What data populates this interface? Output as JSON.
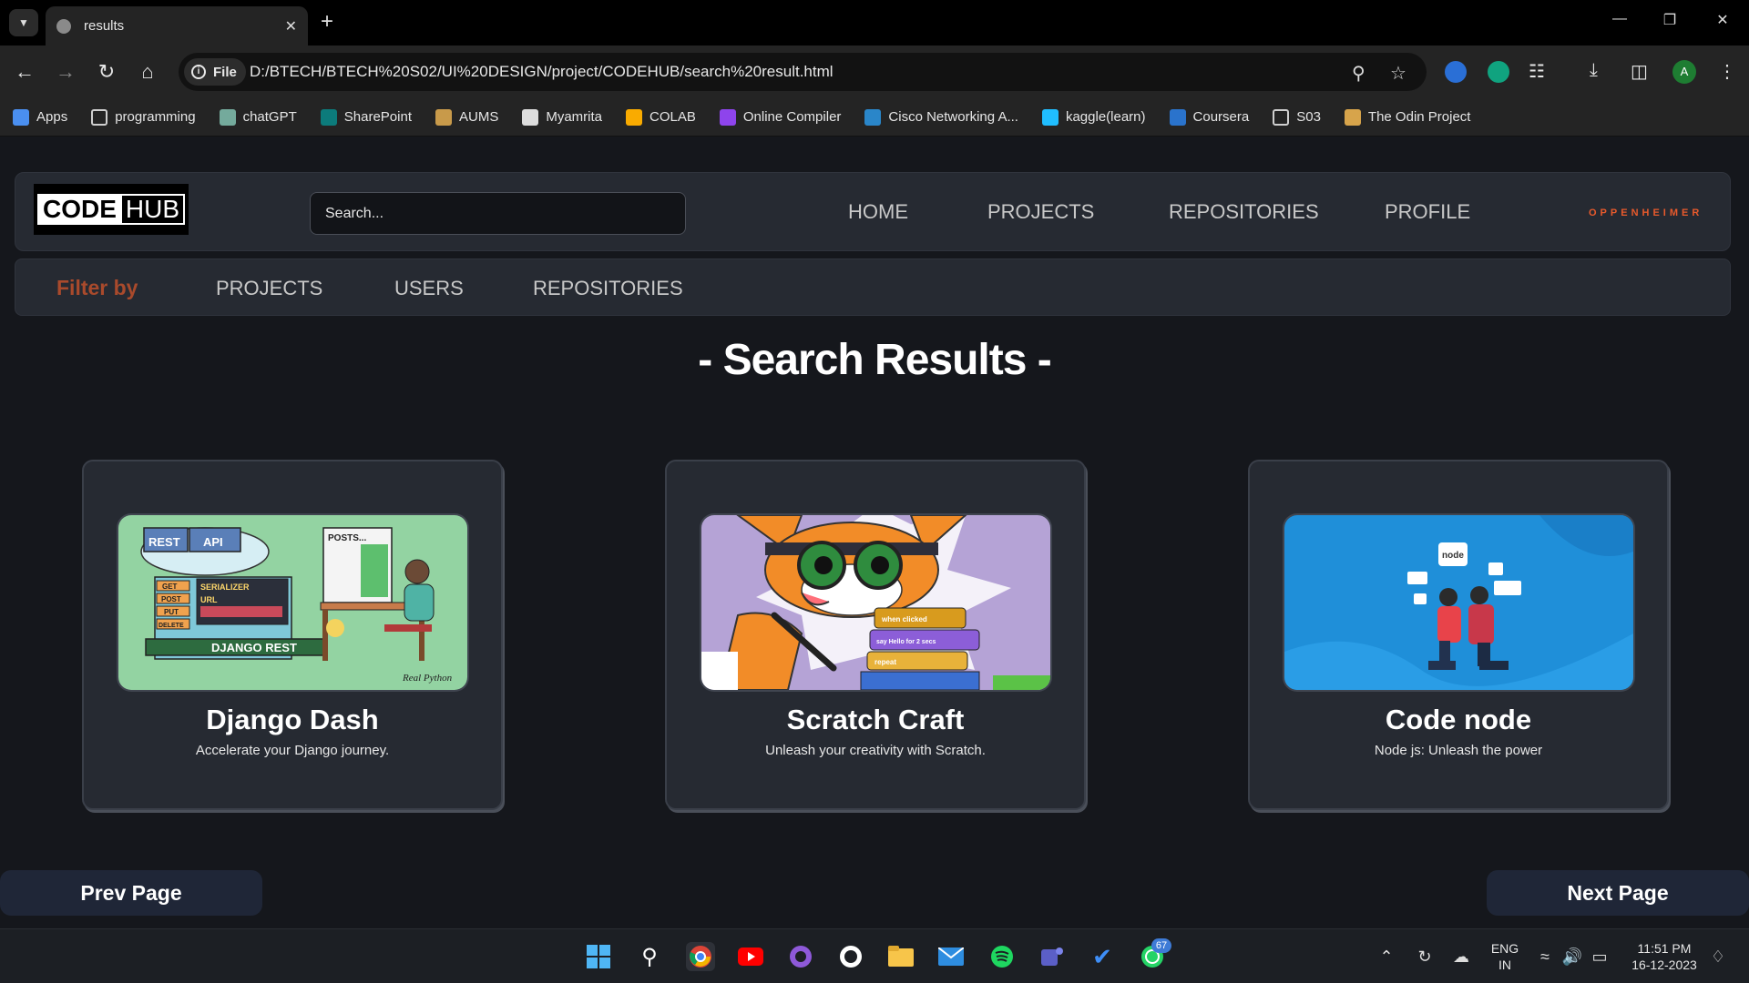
{
  "browser": {
    "tab_title": "results",
    "url_scheme_chip": "File",
    "url": "D:/BTECH/BTECH%20S02/UI%20DESIGN/project/CODEHUB/search%20result.html",
    "profile_initial": "A"
  },
  "bookmarks": [
    {
      "label": "Apps",
      "icon": "apps-grid-icon",
      "color": "#4a8ff0"
    },
    {
      "label": "programming",
      "icon": "folder-icon",
      "color": "#cfcfcf"
    },
    {
      "label": "chatGPT",
      "icon": "chatgpt-icon",
      "color": "#74aa9c"
    },
    {
      "label": "SharePoint",
      "icon": "sharepoint-icon",
      "color": "#0c7b7b"
    },
    {
      "label": "AUMS",
      "icon": "aums-icon",
      "color": "#c89a4a"
    },
    {
      "label": "Myamrita",
      "icon": "myamrita-icon",
      "color": "#dddddd"
    },
    {
      "label": "COLAB",
      "icon": "colab-icon",
      "color": "#f9ab00"
    },
    {
      "label": "Online Compiler",
      "icon": "compiler-icon",
      "color": "#8e44ec"
    },
    {
      "label": "Cisco Networking A...",
      "icon": "cisco-icon",
      "color": "#2a86c9"
    },
    {
      "label": "kaggle(learn)",
      "icon": "kaggle-icon",
      "color": "#20beff"
    },
    {
      "label": "Coursera",
      "icon": "coursera-icon",
      "color": "#2a73cc"
    },
    {
      "label": "S03",
      "icon": "folder-icon",
      "color": "#cfcfcf"
    },
    {
      "label": "The Odin Project",
      "icon": "odin-icon",
      "color": "#d7a44b"
    }
  ],
  "header": {
    "logo_code": "CODE",
    "logo_hub": "HUB",
    "search_placeholder": "Search...",
    "nav": [
      "HOME",
      "PROJECTS",
      "REPOSITORIES",
      "PROFILE"
    ],
    "username": "OPPENHEIMER"
  },
  "filter": {
    "label": "Filter by",
    "options": [
      "PROJECTS",
      "USERS",
      "REPOSITORIES"
    ]
  },
  "results_title": "- Search Results -",
  "cards": [
    {
      "title": "Django Dash",
      "description": "Accelerate your Django journey."
    },
    {
      "title": "Scratch Craft",
      "description": "Unleash your creativity with Scratch."
    },
    {
      "title": "Code node",
      "description": "Node js: Unleash the power"
    }
  ],
  "card_image_text": {
    "django": {
      "rest": "REST",
      "api": "API",
      "posts": "POSTS...",
      "serializer": "SERIALIZER",
      "url": "URL",
      "methods": [
        "GET",
        "POST",
        "PUT",
        "DELETE"
      ],
      "banner": "DJANGO REST",
      "brand": "Real Python"
    },
    "scratch": {
      "blocks": [
        "when clicked",
        "say Hello for 2 secs",
        "repeat"
      ]
    },
    "node": {
      "logo": "node"
    }
  },
  "pagination": {
    "prev": "Prev Page",
    "next": "Next Page"
  },
  "taskbar": {
    "whatsapp_badge": "67",
    "lang_top": "ENG",
    "lang_bottom": "IN",
    "time": "11:51 PM",
    "date": "16-12-2023"
  },
  "colors": {
    "accent_orange": "#e85a2c",
    "filter_label": "#a94a2c",
    "card_bg": "#262a32",
    "page_bg": "#15171c",
    "button_bg": "#1f2637"
  }
}
